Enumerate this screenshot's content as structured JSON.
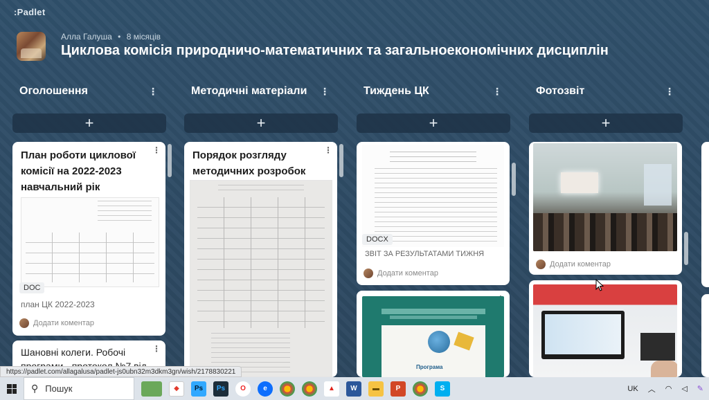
{
  "app": {
    "logo": ":Padlet"
  },
  "header": {
    "author": "Алла Галуша",
    "separator": "•",
    "time": "8 місяців",
    "title": "Циклова комісія природничо-математичних та загальноекономічних дисциплін"
  },
  "columns": [
    {
      "title": "Оголошення",
      "menu": "⋮",
      "add": "+"
    },
    {
      "title": "Методичні матеріали",
      "menu": "⋮",
      "add": "+"
    },
    {
      "title": "Тиждень ЦК",
      "menu": "⋮",
      "add": "+"
    },
    {
      "title": "Фотозвіт",
      "menu": "⋮",
      "add": "+"
    }
  ],
  "cards": {
    "c1": {
      "title": "План роботи циклової комісії на 2022-2023 навчальний рік",
      "badge": "DOC",
      "caption": "план ЦК 2022-2023",
      "comment": "Додати коментар",
      "dots": "⋮"
    },
    "c1b": {
      "title": "Шановні колеги. Робочі програми - протокол №7 від",
      "dots": "⋮"
    },
    "c2": {
      "title": "Порядок розгляду методичних розробок",
      "dots": "⋮"
    },
    "c3": {
      "badge": "DOCX",
      "caption": "ЗВІТ ЗА РЕЗУЛЬТАТАМИ ТИЖНЯ",
      "comment": "Додати коментар",
      "dots": "⋮"
    },
    "c3b": {
      "dots": "⋮",
      "doc_heading": "Програма"
    },
    "c4": {
      "comment": "Додати коментар",
      "dots": "⋮"
    },
    "c4b": {
      "dots": "⋮"
    }
  },
  "status_url": "https://padlet.com/allagalusa/padlet-js0ubn32m3dkm3gn/wish/2178830221",
  "taskbar": {
    "search": "Пошук",
    "lang": "UK",
    "tray_icons": [
      "chevron-up-icon",
      "wifi-icon",
      "volume-icon",
      "pen-icon"
    ]
  },
  "colors": {
    "board_bg": "#2f4a63",
    "card": "#ffffff",
    "taskbar": "#dde3ea"
  }
}
